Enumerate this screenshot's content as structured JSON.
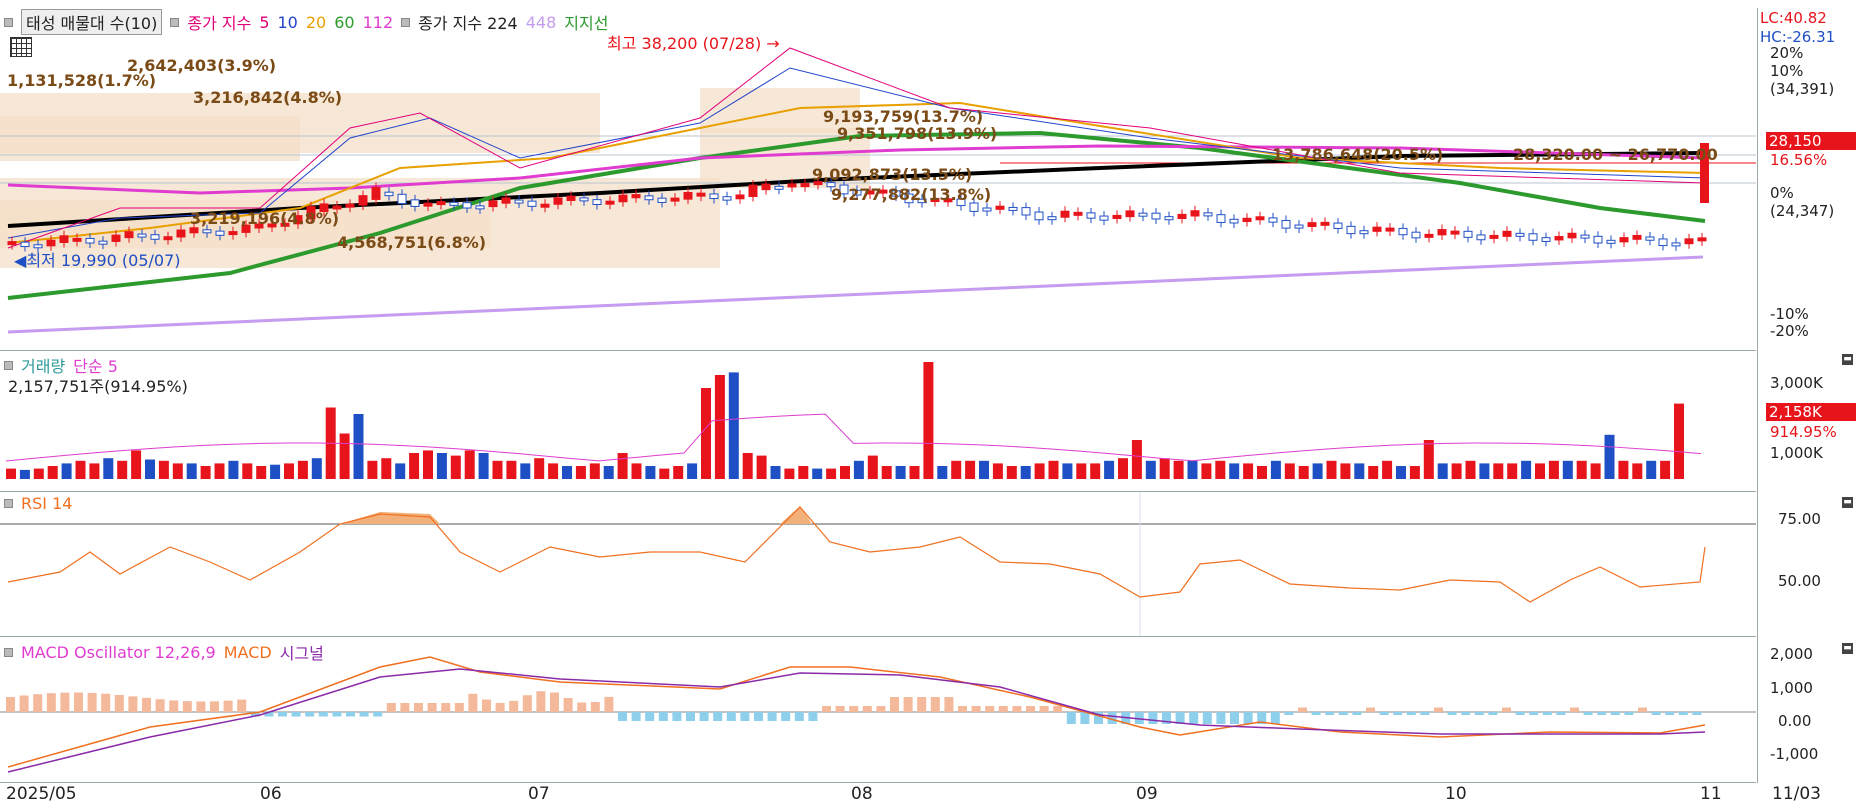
{
  "price_panel": {
    "legend": {
      "button": "태성 매물대 수(10)",
      "ma_title": "종가 지수",
      "ma_periods": [
        {
          "label": "5",
          "color": "#e2007a"
        },
        {
          "label": "10",
          "color": "#2244cc"
        },
        {
          "label": "20",
          "color": "#e8a000"
        },
        {
          "label": "60",
          "color": "#2c9a2c"
        },
        {
          "label": "112",
          "color": "#e03cd0"
        }
      ],
      "ma2_title": "종가 지수 224",
      "ma2_extra": {
        "label": "448",
        "color": "#c59cf0"
      },
      "support": "지지선"
    },
    "grid_icon": "grid-icon",
    "high_label": "최고 38,200 (07/28)",
    "low_label": "최저 19,990 (05/07)",
    "volume_profile": [
      "2,642,403(3.9%)",
      "1,131,528(1.7%)",
      "3,216,842(4.8%)",
      "3,219,196(4.8%)",
      "4,568,751(6.8%)",
      "9,193,759(13.7%)",
      "9,351,798(13.9%)",
      "9,092,873(13.5%)",
      "9,277,882(13.8%)",
      "13,786,648(20.5%)"
    ],
    "range_label": "28,320.00 ~ 26,770.00",
    "right_axis": [
      "LC:40.82",
      "HC:-26.31",
      "20%",
      "10%",
      "(34,391)",
      "0%",
      "(24,347)",
      "-10%",
      "-20%"
    ],
    "current_price": "28,150",
    "current_change": "16.56%"
  },
  "volume_panel": {
    "title": "거래량",
    "ma_label": "단순 5",
    "info": "2,157,751주(914.95%)",
    "axis": [
      "3,000K",
      "1,000K"
    ],
    "current": "2,158K",
    "current_pct": "914.95%"
  },
  "rsi_panel": {
    "title": "RSI 14",
    "axis": [
      "75.00",
      "50.00"
    ]
  },
  "macd_panel": {
    "osc": "MACD Oscillator 12,26,9",
    "macd": "MACD",
    "signal": "시그널",
    "axis": [
      "2,000",
      "1,000",
      "0.00",
      "-1,000"
    ]
  },
  "x_axis": [
    "2025/05",
    "06",
    "07",
    "08",
    "09",
    "10",
    "11",
    "11/03"
  ],
  "colors": {
    "up": "#e8141b",
    "down": "#1f4fc4",
    "ma224": "#000000",
    "ma60": "#2c9a2c",
    "ma112": "#e03cd0",
    "ma20": "#e8a000",
    "ma448": "#c59cf0",
    "vp": "#f4dfc8"
  }
}
